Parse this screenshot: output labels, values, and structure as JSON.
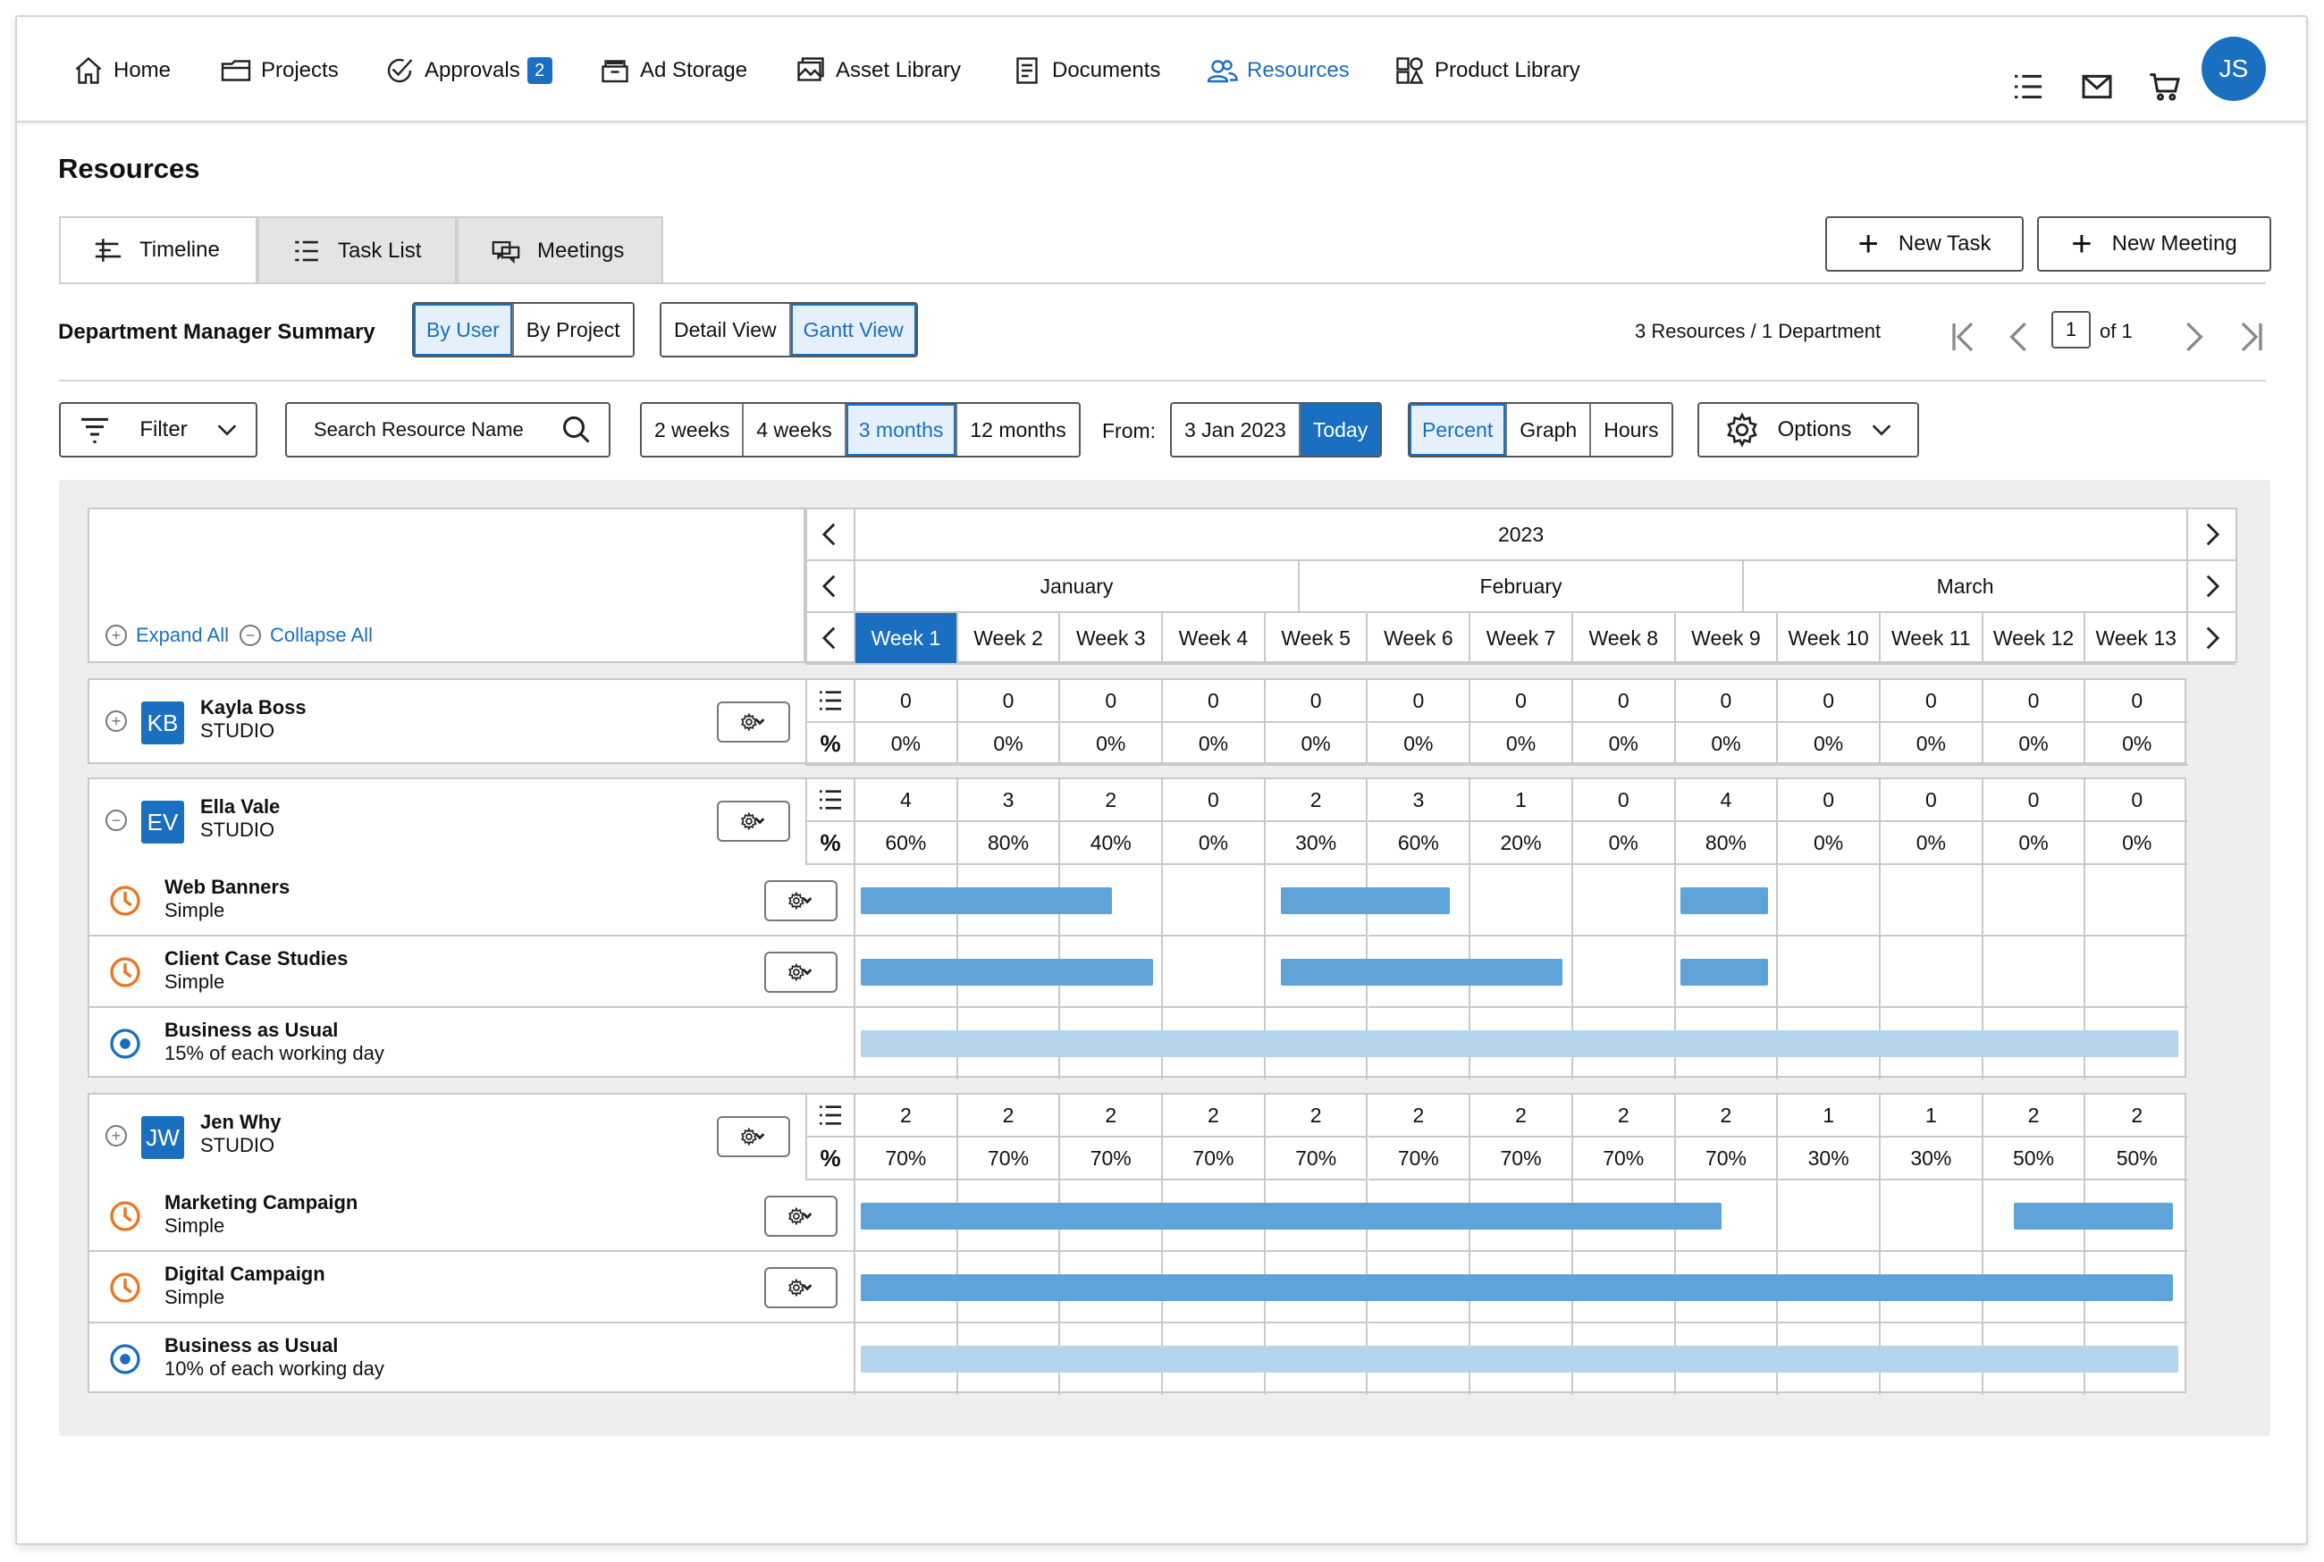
{
  "nav": {
    "items": [
      {
        "label": "Home",
        "icon": "home-icon"
      },
      {
        "label": "Projects",
        "icon": "folder-icon"
      },
      {
        "label": "Approvals",
        "icon": "check-circle-icon",
        "badge": "2"
      },
      {
        "label": "Ad Storage",
        "icon": "storage-box-icon"
      },
      {
        "label": "Asset Library",
        "icon": "image-gallery-icon"
      },
      {
        "label": "Documents",
        "icon": "document-icon"
      },
      {
        "label": "Resources",
        "icon": "people-icon",
        "active": true
      },
      {
        "label": "Product Library",
        "icon": "product-icon"
      }
    ],
    "right_icons": [
      "list-icon",
      "mail-icon",
      "cart-icon"
    ],
    "avatar": "JS",
    "accent": "#1a6fc1"
  },
  "page": {
    "title": "Resources"
  },
  "tabs": [
    {
      "label": "Timeline",
      "active": true
    },
    {
      "label": "Task List"
    },
    {
      "label": "Meetings"
    }
  ],
  "actions": {
    "new_task": "New Task",
    "new_meeting": "New Meeting"
  },
  "summary": {
    "label": "Department Manager Summary",
    "group_by": [
      "By User",
      "By Project"
    ],
    "group_selected": "By User",
    "views": [
      "Detail View",
      "Gantt View"
    ],
    "view_selected": "Gantt View",
    "count": "3 Resources / 1 Department",
    "page": "1",
    "page_of": "of 1"
  },
  "toolbar": {
    "filter": "Filter",
    "search_placeholder": "Search Resource Name",
    "ranges": [
      "2 weeks",
      "4 weeks",
      "3 months",
      "12 months"
    ],
    "range_selected": "3 months",
    "from_label": "From:",
    "from_date": "3 Jan 2023",
    "today": "Today",
    "modes": [
      "Percent",
      "Graph",
      "Hours"
    ],
    "mode_selected": "Percent",
    "options": "Options"
  },
  "gantt": {
    "expand_all": "Expand All",
    "collapse_all": "Collapse All",
    "year": "2023",
    "months": [
      "January",
      "February",
      "March"
    ],
    "weeks": [
      "Week 1",
      "Week 2",
      "Week 3",
      "Week 4",
      "Week 5",
      "Week 6",
      "Week 7",
      "Week 8",
      "Week 9",
      "Week 10",
      "Week 11",
      "Week 12",
      "Week 13"
    ],
    "current_week": "Week 1",
    "resources": [
      {
        "initials": "KB",
        "name": "Kayla Boss",
        "dept": "STUDIO",
        "expanded": false,
        "counts": [
          "0",
          "0",
          "0",
          "0",
          "0",
          "0",
          "0",
          "0",
          "0",
          "0",
          "0",
          "0",
          "0"
        ],
        "percents": [
          "0%",
          "0%",
          "0%",
          "0%",
          "0%",
          "0%",
          "0%",
          "0%",
          "0%",
          "0%",
          "0%",
          "0%",
          "0%"
        ],
        "tasks": []
      },
      {
        "initials": "EV",
        "name": "Ella Vale",
        "dept": "STUDIO",
        "expanded": true,
        "counts": [
          "4",
          "3",
          "2",
          "0",
          "2",
          "3",
          "1",
          "0",
          "4",
          "0",
          "0",
          "0",
          "0"
        ],
        "percents": [
          "60%",
          "80%",
          "40%",
          "0%",
          "30%",
          "60%",
          "20%",
          "0%",
          "80%",
          "0%",
          "0%",
          "0%",
          "0%"
        ],
        "tasks": [
          {
            "name": "Web Banners",
            "sub": "Simple",
            "kind": "task",
            "bars": [
              [
                0.05,
                2.5
              ],
              [
                4.15,
                5.8
              ],
              [
                8.05,
                8.9
              ]
            ]
          },
          {
            "name": "Client Case Studies",
            "sub": "Simple",
            "kind": "task",
            "bars": [
              [
                0.05,
                2.9
              ],
              [
                4.15,
                6.9
              ],
              [
                8.05,
                8.9
              ]
            ]
          },
          {
            "name": "Business as Usual",
            "sub": "15% of each working day",
            "kind": "bau",
            "bars": [
              [
                0.05,
                12.9
              ]
            ]
          }
        ]
      },
      {
        "initials": "JW",
        "name": "Jen Why",
        "dept": "STUDIO",
        "expanded": false,
        "counts": [
          "2",
          "2",
          "2",
          "2",
          "2",
          "2",
          "2",
          "2",
          "2",
          "1",
          "1",
          "2",
          "2"
        ],
        "percents": [
          "70%",
          "70%",
          "70%",
          "70%",
          "70%",
          "70%",
          "70%",
          "70%",
          "70%",
          "30%",
          "30%",
          "50%",
          "50%"
        ],
        "tasks": [
          {
            "name": "Marketing Campaign",
            "sub": "Simple",
            "kind": "task",
            "bars": [
              [
                0.05,
                8.45
              ],
              [
                11.3,
                12.85
              ]
            ]
          },
          {
            "name": "Digital Campaign",
            "sub": "Simple",
            "kind": "task",
            "bars": [
              [
                0.05,
                12.85
              ]
            ]
          },
          {
            "name": "Business as Usual",
            "sub": "10% of each working day",
            "kind": "bau",
            "bars": [
              [
                0.05,
                12.9
              ]
            ]
          }
        ]
      }
    ]
  }
}
